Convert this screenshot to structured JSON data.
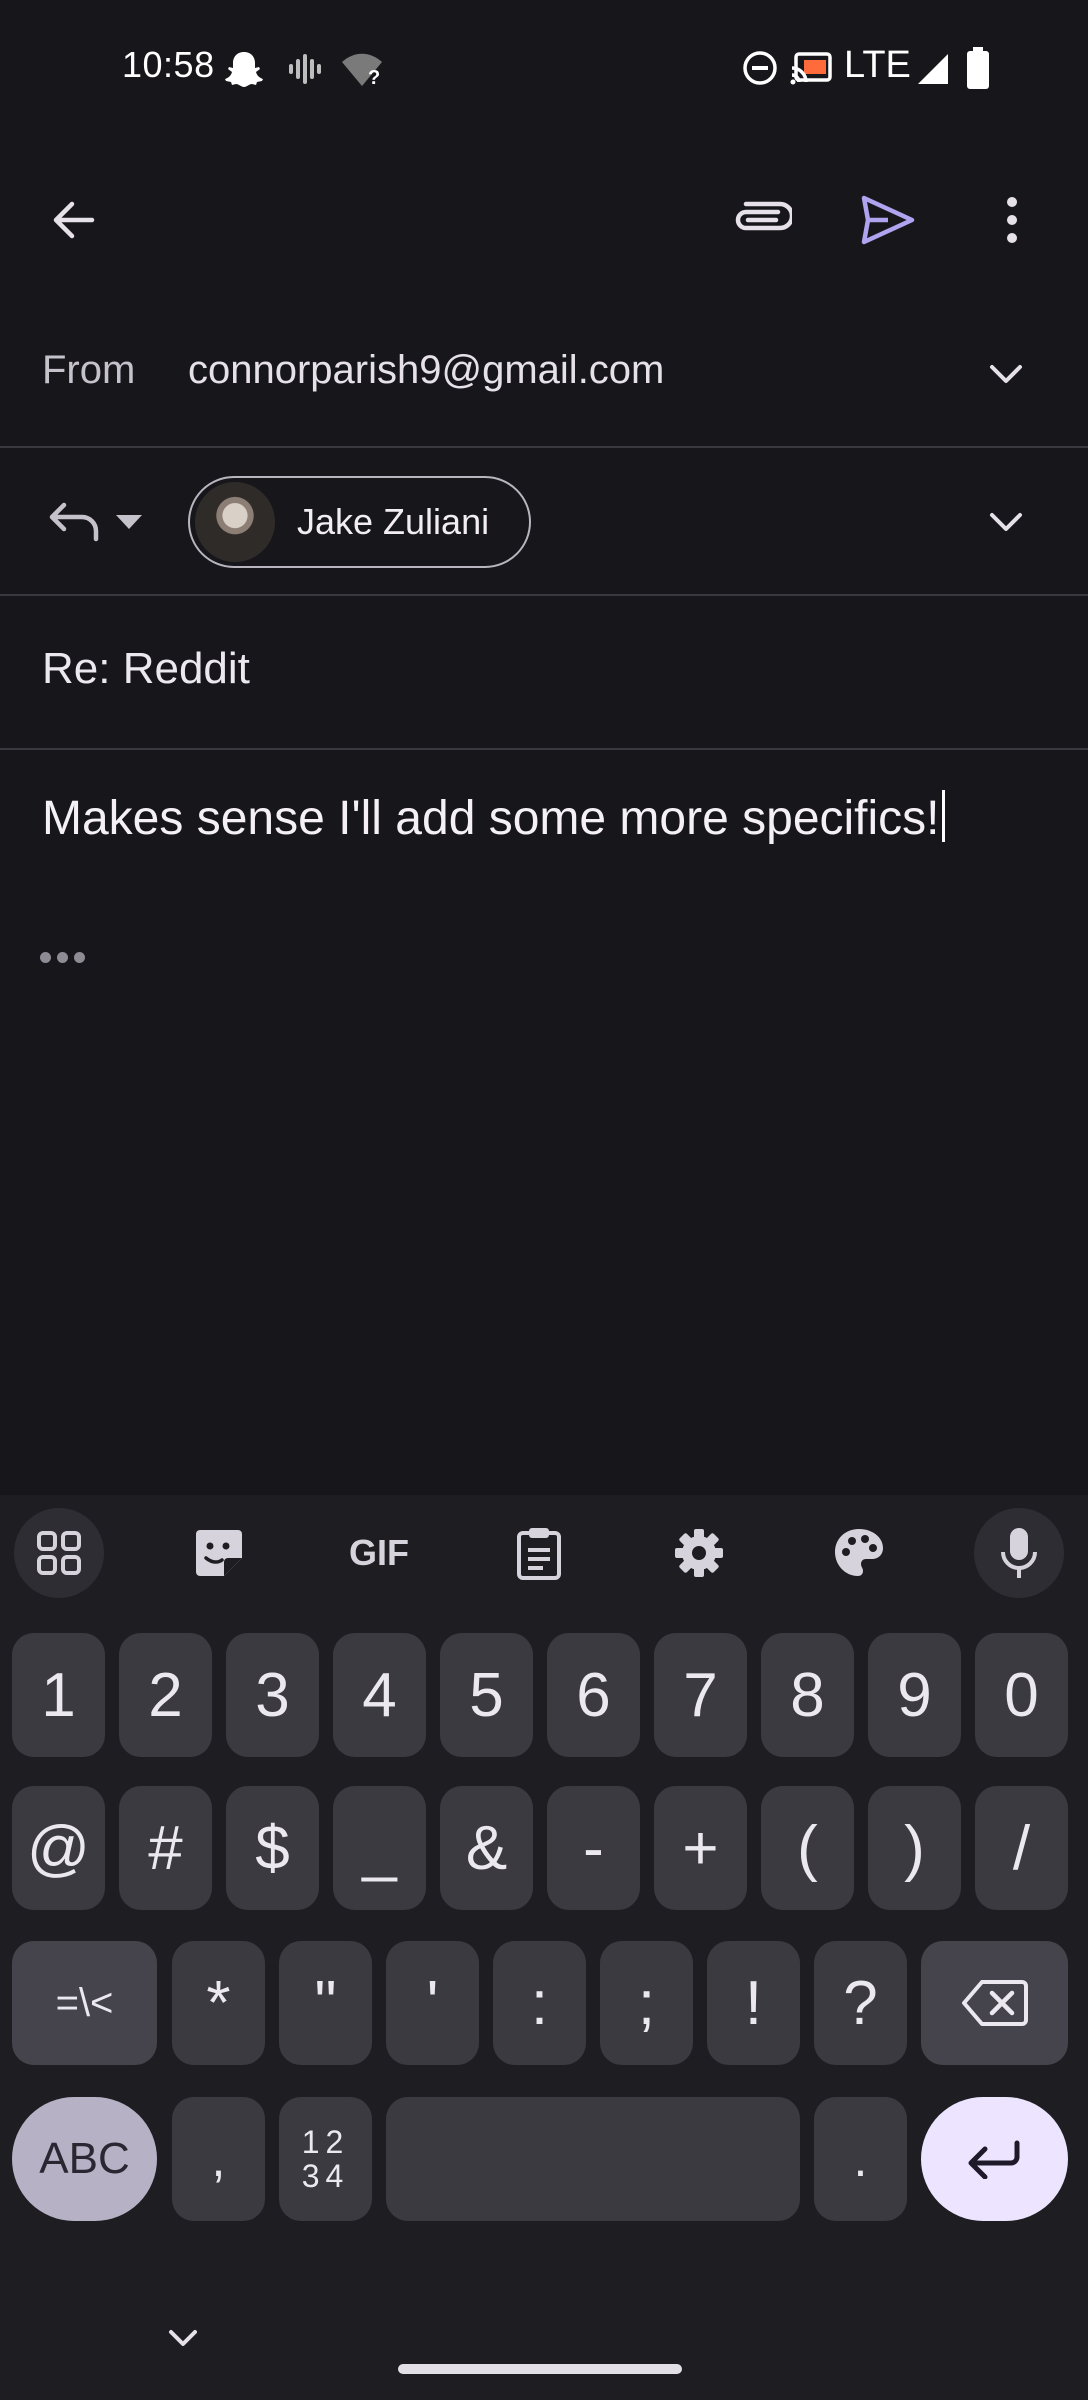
{
  "status_bar": {
    "time": "10:58",
    "network": "LTE",
    "icons": [
      "snapchat-icon",
      "vibrate-icon",
      "wifi-unknown-icon",
      "dnd-icon",
      "cast-icon",
      "signal-icon",
      "battery-icon"
    ]
  },
  "app_bar": {
    "icons": [
      "back-arrow-icon",
      "attach-icon",
      "send-icon",
      "more-vert-icon"
    ],
    "accent_color": "#b0a4f0"
  },
  "compose": {
    "from_label": "From",
    "from_value": "connorparish9@gmail.com",
    "recipient_name": "Jake Zuliani",
    "subject": "Re: Reddit",
    "body": "Makes sense I'll add some more specifics!"
  },
  "keyboard": {
    "toolbar": [
      "apps-grid-icon",
      "sticker-icon",
      "GIF",
      "clipboard-icon",
      "settings-gear-icon",
      "palette-icon",
      "mic-icon"
    ],
    "gif_label": "GIF",
    "row1": [
      "1",
      "2",
      "3",
      "4",
      "5",
      "6",
      "7",
      "8",
      "9",
      "0"
    ],
    "row2": [
      "@",
      "#",
      "$",
      "_",
      "&",
      "-",
      "+",
      "(",
      ")",
      "/"
    ],
    "row3": [
      "*",
      "\"",
      "'",
      ":",
      ";",
      "!",
      "?"
    ],
    "shift_symbols": "=\\<",
    "abc_label": "ABC",
    "comma": ",",
    "numpad_top": "12",
    "numpad_bottom": "34",
    "period": "."
  }
}
